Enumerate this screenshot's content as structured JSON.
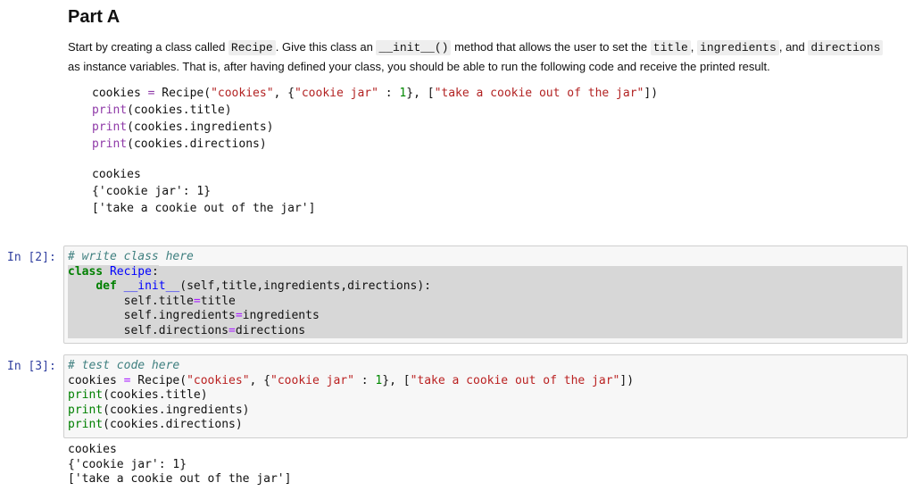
{
  "markdown": {
    "heading": "Part A",
    "para": {
      "t1": "Start by creating a class called ",
      "c1": "Recipe",
      "t2": ". Give this class an ",
      "c2": "__init__()",
      "t3": " method that allows the user to set the ",
      "c3": "title",
      "t4": ", ",
      "c4": "ingredients",
      "t5": ", and ",
      "c5": "directions",
      "t6": " as instance variables. That is, after having defined your class, you should be able to run the following code and receive the printed result."
    },
    "code_lines": [
      "cookies = Recipe(\"cookies\", {\"cookie jar\" : 1}, [\"take a cookie out of the jar\"])",
      "print(cookies.title)",
      "print(cookies.ingredients)",
      "print(cookies.directions)"
    ],
    "output_lines": [
      "cookies",
      "{'cookie jar': 1}",
      "['take a cookie out of the jar']"
    ]
  },
  "cells": [
    {
      "prompt": "In [2]:",
      "comment": "# write class here",
      "lines": [
        "class Recipe:",
        "    def __init__(self,title,ingredients,directions):",
        "        self.title=title",
        "        self.ingredients=ingredients",
        "        self.directions=directions"
      ]
    },
    {
      "prompt": "In [3]:",
      "comment": "# test code here",
      "lines": [
        "cookies = Recipe(\"cookies\", {\"cookie jar\" : 1}, [\"take a cookie out of the jar\"])",
        "print(cookies.title)",
        "print(cookies.ingredients)",
        "print(cookies.directions)"
      ],
      "output": [
        "cookies",
        "{'cookie jar': 1}",
        "['take a cookie out of the jar']"
      ]
    }
  ]
}
